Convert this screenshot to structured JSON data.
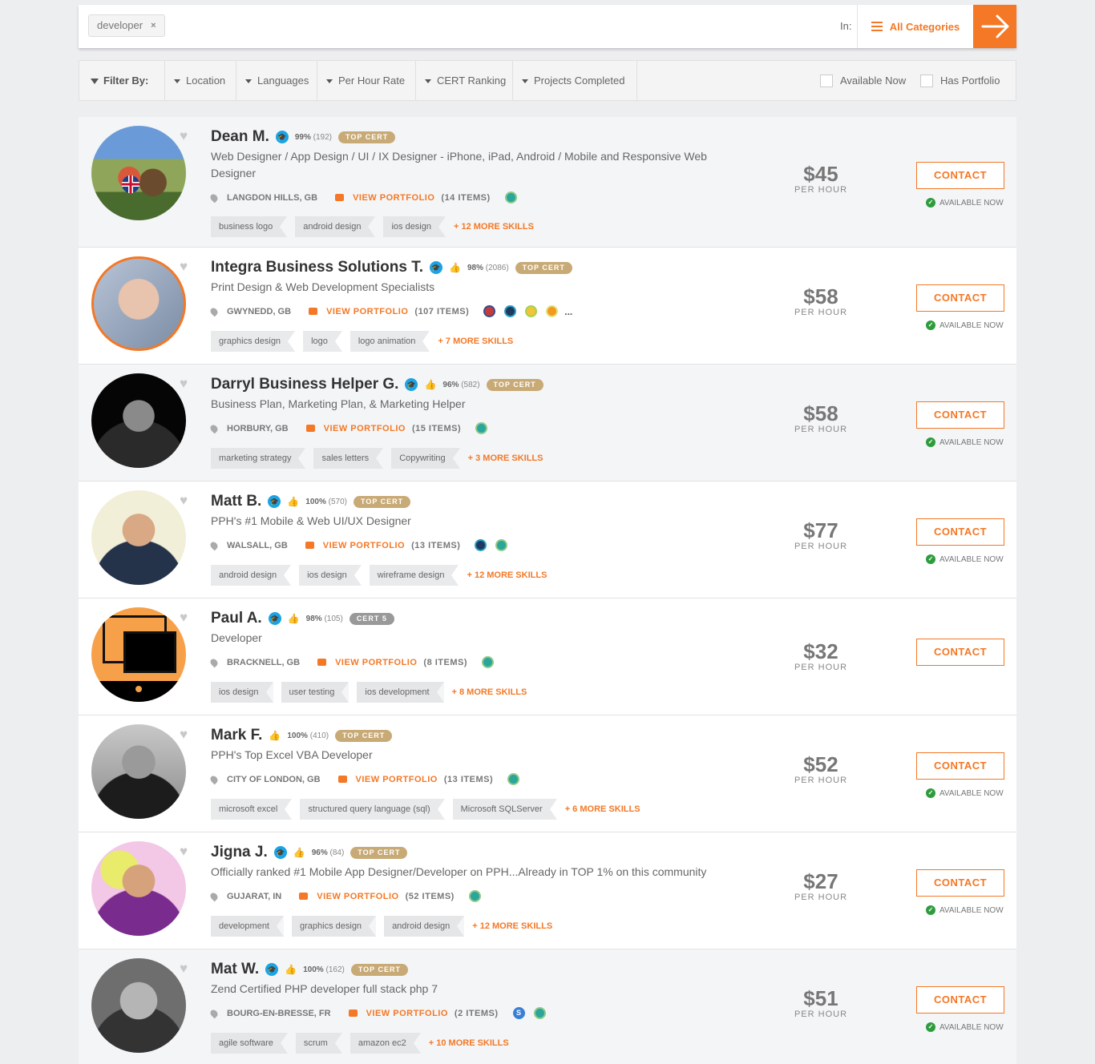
{
  "search": {
    "chip": "developer",
    "chip_remove": "×",
    "in_label": "In:",
    "category": "All Categories"
  },
  "filters": {
    "label": "Filter By:",
    "items": [
      "Location",
      "Languages",
      "Per Hour Rate",
      "CERT Ranking",
      "Projects Completed"
    ],
    "available_now": "Available Now",
    "has_portfolio": "Has Portfolio"
  },
  "common": {
    "per_hour": "PER HOUR",
    "contact": "CONTACT",
    "available": "AVAILABLE NOW",
    "view_portfolio": "VIEW PORTFOLIO",
    "brand_color": "#f47825"
  },
  "freelancers": [
    {
      "name": "Dean M.",
      "score": "99%",
      "count": "(192)",
      "cert": "TOP CERT",
      "title": "Web Designer / App Design / UI / IX Designer - iPhone, iPad, Android / Mobile and Responsive Web Designer",
      "location": "LANGDON HILLS, GB",
      "items": "(14 ITEMS)",
      "skills": [
        "business logo",
        "android design",
        "ios design"
      ],
      "more": "+ 12 MORE SKILLS",
      "price": "$45",
      "available": true
    },
    {
      "name": "Integra Business Solutions T.",
      "score": "98%",
      "count": "(2086)",
      "cert": "TOP CERT",
      "title": "Print Design & Web Development Specialists",
      "location": "GWYNEDD, GB",
      "items": "(107 ITEMS)",
      "skills": [
        "graphics design",
        "logo",
        "logo animation"
      ],
      "more": "+ 7 MORE SKILLS",
      "price": "$58",
      "available": true,
      "badge_more": "..."
    },
    {
      "name": "Darryl Business Helper G.",
      "score": "96%",
      "count": "(582)",
      "cert": "TOP CERT",
      "title": "Business Plan, Marketing Plan, & Marketing Helper",
      "location": "HORBURY, GB",
      "items": "(15 ITEMS)",
      "skills": [
        "marketing strategy",
        "sales letters",
        "Copywriting"
      ],
      "more": "+ 3 MORE SKILLS",
      "price": "$58",
      "available": true
    },
    {
      "name": "Matt B.",
      "score": "100%",
      "count": "(570)",
      "cert": "TOP CERT",
      "title": "PPH's #1 Mobile & Web UI/UX Designer",
      "location": "WALSALL, GB",
      "items": "(13 ITEMS)",
      "skills": [
        "android design",
        "ios design",
        "wireframe design"
      ],
      "more": "+ 12 MORE SKILLS",
      "price": "$77",
      "available": true
    },
    {
      "name": "Paul A.",
      "score": "98%",
      "count": "(105)",
      "cert": "CERT 5",
      "title": "Developer",
      "location": "BRACKNELL, GB",
      "items": "(8 ITEMS)",
      "skills": [
        "ios design",
        "user testing",
        "ios development"
      ],
      "more": "+ 8 MORE SKILLS",
      "price": "$32",
      "available": false
    },
    {
      "name": "Mark F.",
      "score": "100%",
      "count": "(410)",
      "cert": "TOP CERT",
      "title": "PPH's Top Excel VBA Developer",
      "location": "CITY OF LONDON, GB",
      "items": "(13 ITEMS)",
      "skills": [
        "microsoft excel",
        "structured query language (sql)",
        "Microsoft SQLServer"
      ],
      "more": "+ 6 MORE SKILLS",
      "price": "$52",
      "available": true
    },
    {
      "name": "Jigna J.",
      "score": "96%",
      "count": "(84)",
      "cert": "TOP CERT",
      "title": "Officially ranked #1 Mobile App Designer/Developer on PPH...Already in TOP 1% on this community",
      "location": "GUJARAT, IN",
      "items": "(52 ITEMS)",
      "skills": [
        "development",
        "graphics design",
        "android design"
      ],
      "more": "+ 12 MORE SKILLS",
      "price": "$27",
      "available": true
    },
    {
      "name": "Mat W.",
      "score": "100%",
      "count": "(162)",
      "cert": "TOP CERT",
      "title": "Zend Certified PHP developer full stack php 7",
      "location": "BOURG-EN-BRESSE, FR",
      "items": "(2 ITEMS)",
      "skills": [
        "agile software",
        "scrum",
        "amazon ec2"
      ],
      "more": "+ 10 MORE SKILLS",
      "price": "$51",
      "available": true,
      "s_badge": "S"
    }
  ]
}
